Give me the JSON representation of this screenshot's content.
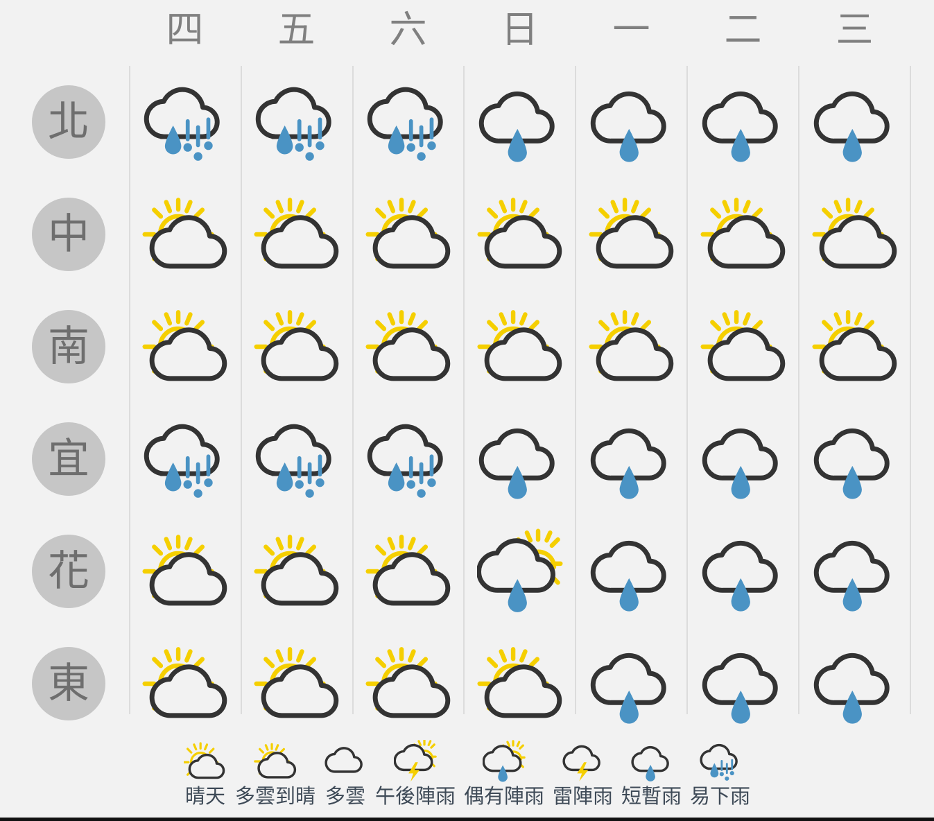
{
  "colors": {
    "background": "#f2f2f2",
    "separator": "#dcdcdc",
    "badge_fill": "#c6c6c6",
    "badge_text": "#6e6e6e",
    "day_header_text": "#808080",
    "cloud_outline": "#333333",
    "sun_yellow": "#f5cf00",
    "rain_blue": "#4a93c4",
    "legend_text": "#3e4a57",
    "bottom_border": "#111111"
  },
  "header": {
    "days": [
      {
        "label": "四"
      },
      {
        "label": "五"
      },
      {
        "label": "六"
      },
      {
        "label": "日"
      },
      {
        "label": "一"
      },
      {
        "label": "二"
      },
      {
        "label": "三"
      }
    ]
  },
  "rows": [
    {
      "region": "北",
      "cells": [
        {
          "icon": "heavy-rain-icon",
          "condition": "易下雨"
        },
        {
          "icon": "heavy-rain-icon",
          "condition": "易下雨"
        },
        {
          "icon": "heavy-rain-icon",
          "condition": "易下雨"
        },
        {
          "icon": "rain-icon",
          "condition": "短暫雨"
        },
        {
          "icon": "rain-icon",
          "condition": "短暫雨"
        },
        {
          "icon": "rain-icon",
          "condition": "短暫雨"
        },
        {
          "icon": "rain-icon",
          "condition": "短暫雨"
        }
      ]
    },
    {
      "region": "中",
      "cells": [
        {
          "icon": "sun-cloud-icon",
          "condition": "多雲到晴"
        },
        {
          "icon": "sun-cloud-icon",
          "condition": "多雲到晴"
        },
        {
          "icon": "sun-cloud-icon",
          "condition": "多雲到晴"
        },
        {
          "icon": "sun-cloud-icon",
          "condition": "多雲到晴"
        },
        {
          "icon": "sun-cloud-icon",
          "condition": "多雲到晴"
        },
        {
          "icon": "sun-cloud-icon",
          "condition": "多雲到晴"
        },
        {
          "icon": "sun-cloud-icon",
          "condition": "多雲到晴"
        }
      ]
    },
    {
      "region": "南",
      "cells": [
        {
          "icon": "sun-cloud-icon",
          "condition": "多雲到晴"
        },
        {
          "icon": "sun-cloud-icon",
          "condition": "多雲到晴"
        },
        {
          "icon": "sun-cloud-icon",
          "condition": "多雲到晴"
        },
        {
          "icon": "sun-cloud-icon",
          "condition": "多雲到晴"
        },
        {
          "icon": "sun-cloud-icon",
          "condition": "多雲到晴"
        },
        {
          "icon": "sun-cloud-icon",
          "condition": "多雲到晴"
        },
        {
          "icon": "sun-cloud-icon",
          "condition": "多雲到晴"
        }
      ]
    },
    {
      "region": "宜",
      "cells": [
        {
          "icon": "heavy-rain-icon",
          "condition": "易下雨"
        },
        {
          "icon": "heavy-rain-icon",
          "condition": "易下雨"
        },
        {
          "icon": "heavy-rain-icon",
          "condition": "易下雨"
        },
        {
          "icon": "rain-icon",
          "condition": "短暫雨"
        },
        {
          "icon": "rain-icon",
          "condition": "短暫雨"
        },
        {
          "icon": "rain-icon",
          "condition": "短暫雨"
        },
        {
          "icon": "rain-icon",
          "condition": "短暫雨"
        }
      ]
    },
    {
      "region": "花",
      "cells": [
        {
          "icon": "sun-cloud-icon",
          "condition": "多雲到晴"
        },
        {
          "icon": "sun-cloud-icon",
          "condition": "多雲到晴"
        },
        {
          "icon": "sun-cloud-icon",
          "condition": "多雲到晴"
        },
        {
          "icon": "sun-cloud-rain-icon",
          "condition": "偶有陣雨"
        },
        {
          "icon": "rain-icon",
          "condition": "短暫雨"
        },
        {
          "icon": "rain-icon",
          "condition": "短暫雨"
        },
        {
          "icon": "rain-icon",
          "condition": "短暫雨"
        }
      ]
    },
    {
      "region": "東",
      "cells": [
        {
          "icon": "sun-cloud-icon",
          "condition": "多雲到晴"
        },
        {
          "icon": "sun-cloud-icon",
          "condition": "多雲到晴"
        },
        {
          "icon": "sun-cloud-icon",
          "condition": "多雲到晴"
        },
        {
          "icon": "sun-cloud-icon",
          "condition": "多雲到晴"
        },
        {
          "icon": "rain-icon",
          "condition": "短暫雨"
        },
        {
          "icon": "rain-icon",
          "condition": "短暫雨"
        },
        {
          "icon": "rain-icon",
          "condition": "短暫雨"
        }
      ]
    }
  ],
  "legend": {
    "items": [
      {
        "icon": "sunny-icon",
        "label": "晴天"
      },
      {
        "icon": "sun-cloud-icon",
        "label": "多雲到晴"
      },
      {
        "icon": "cloudy-icon",
        "label": "多雲"
      },
      {
        "icon": "afternoon-thunderstorm-icon",
        "label": "午後陣雨"
      },
      {
        "icon": "sun-cloud-rain-icon",
        "label": "偶有陣雨"
      },
      {
        "icon": "thunderstorm-icon",
        "label": "雷陣雨"
      },
      {
        "icon": "rain-icon",
        "label": "短暫雨"
      },
      {
        "icon": "heavy-rain-icon",
        "label": "易下雨"
      }
    ]
  }
}
